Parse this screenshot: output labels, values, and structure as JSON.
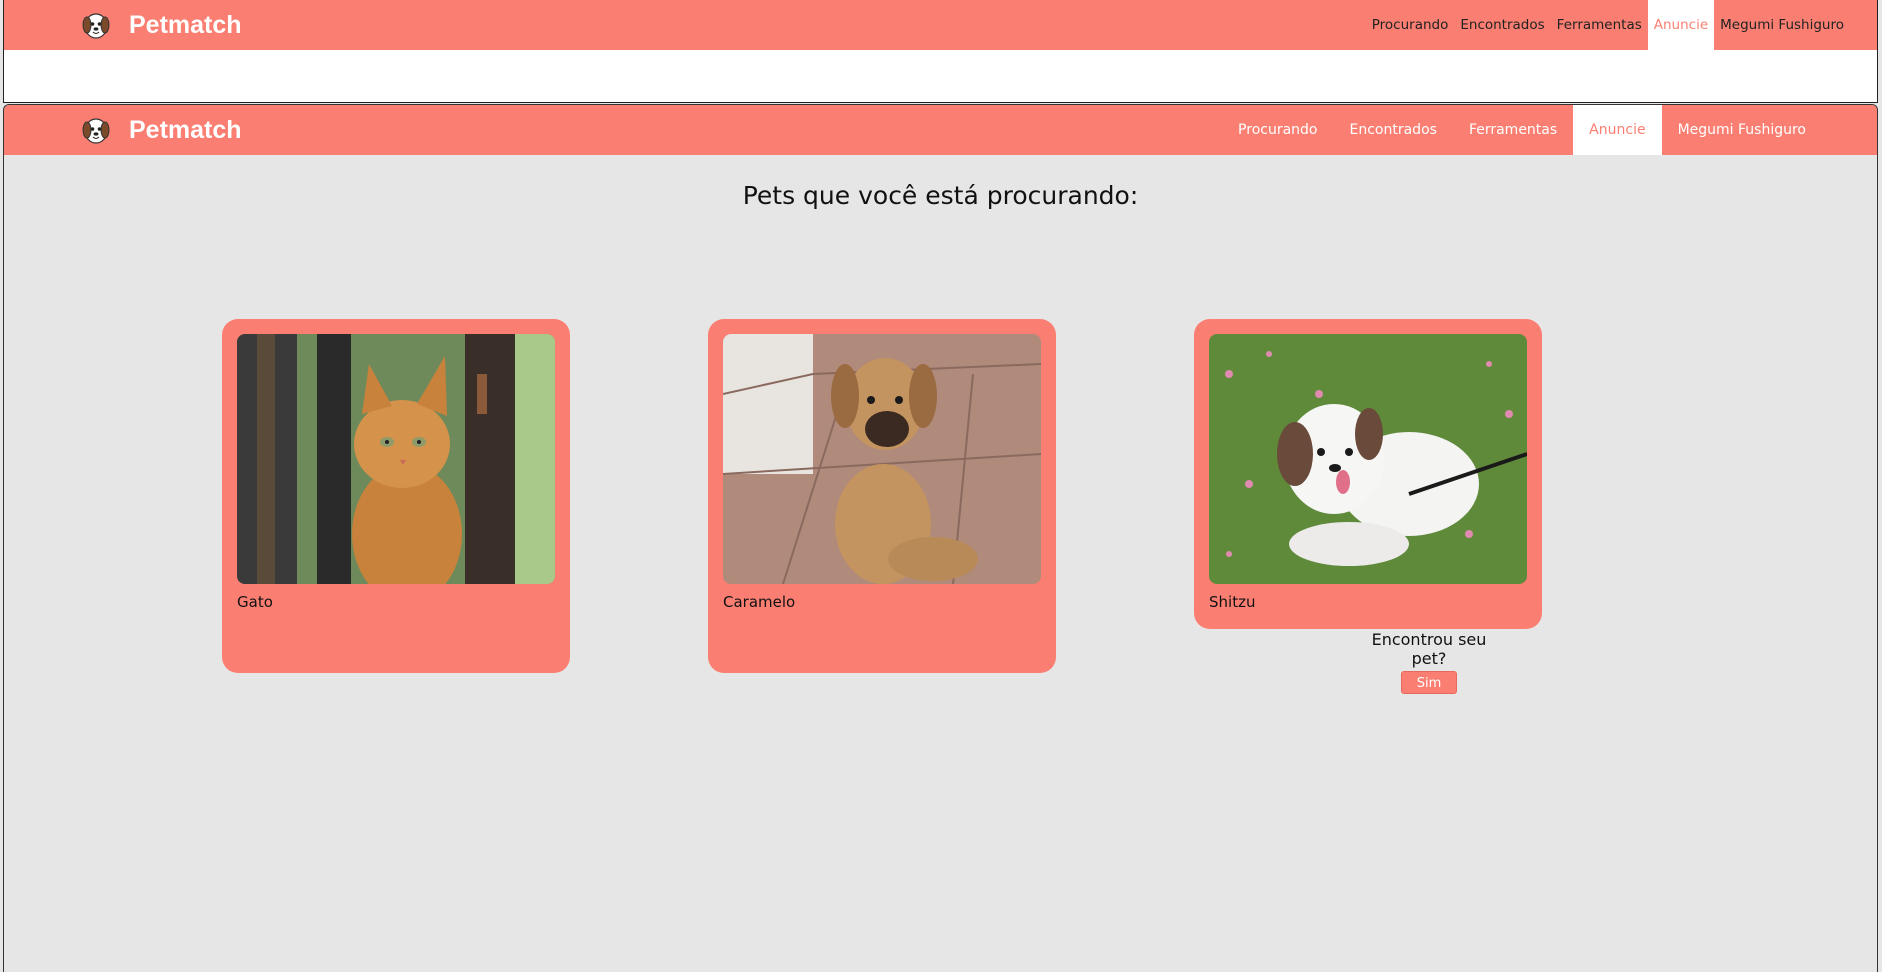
{
  "brand": {
    "name": "Petmatch",
    "logo": "dog-logo-icon"
  },
  "nav": {
    "items": [
      "Procurando",
      "Encontrados",
      "Ferramentas",
      "Anuncie",
      "Megumi Fushiguro"
    ],
    "active": "Anuncie"
  },
  "page": {
    "title": "Pets que você está procurando:"
  },
  "pets": [
    {
      "name": "Gato",
      "photo": "orange-cat-photo"
    },
    {
      "name": "Caramelo",
      "photo": "brown-puppy-photo"
    },
    {
      "name": "Shitzu",
      "photo": "white-shihtzu-photo"
    }
  ],
  "found_prompt": {
    "question": "Encontrou seu pet?",
    "button": "Sim"
  },
  "colors": {
    "brand": "#fa7f72",
    "background": "#e7e6e6",
    "active_text": "#fa7f72"
  }
}
